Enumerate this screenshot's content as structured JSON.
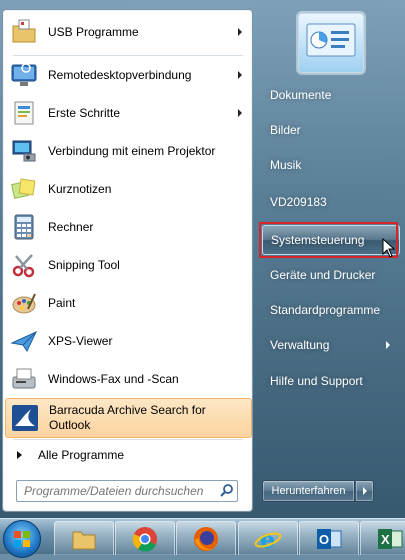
{
  "programs": [
    {
      "label": "USB Programme",
      "icon": "folder-icon",
      "has_submenu": true
    },
    {
      "label": "Remotedesktopverbindung",
      "icon": "remote-desktop-icon",
      "has_submenu": true
    },
    {
      "label": "Erste Schritte",
      "icon": "getting-started-icon",
      "has_submenu": true
    },
    {
      "label": "Verbindung mit einem Projektor",
      "icon": "projector-icon",
      "has_submenu": false
    },
    {
      "label": "Kurznotizen",
      "icon": "sticky-notes-icon",
      "has_submenu": false
    },
    {
      "label": "Rechner",
      "icon": "calculator-icon",
      "has_submenu": false
    },
    {
      "label": "Snipping Tool",
      "icon": "scissors-icon",
      "has_submenu": false
    },
    {
      "label": "Paint",
      "icon": "paint-palette-icon",
      "has_submenu": false
    },
    {
      "label": "XPS-Viewer",
      "icon": "paper-plane-icon",
      "has_submenu": false
    },
    {
      "label": "Windows-Fax und -Scan",
      "icon": "fax-icon",
      "has_submenu": false
    }
  ],
  "highlighted_program": {
    "label": "Barracuda Archive Search for Outlook",
    "icon": "barracuda-icon"
  },
  "all_programs_label": "Alle Programme",
  "search": {
    "placeholder": "Programme/Dateien durchsuchen"
  },
  "places": [
    {
      "label": "Dokumente",
      "selected": false,
      "has_submenu": false
    },
    {
      "label": "Bilder",
      "selected": false,
      "has_submenu": false
    },
    {
      "label": "Musik",
      "selected": false,
      "has_submenu": false
    },
    {
      "label": "VD209183",
      "selected": false,
      "has_submenu": false
    },
    {
      "label": "Systemsteuerung",
      "selected": true,
      "has_submenu": false
    },
    {
      "label": "Geräte und Drucker",
      "selected": false,
      "has_submenu": false
    },
    {
      "label": "Standardprogramme",
      "selected": false,
      "has_submenu": false
    },
    {
      "label": "Verwaltung",
      "selected": false,
      "has_submenu": true
    },
    {
      "label": "Hilfe und Support",
      "selected": false,
      "has_submenu": false
    }
  ],
  "shutdown": {
    "label": "Herunterfahren"
  },
  "taskbar": {
    "items": [
      "start-orb-icon",
      "file-explorer-icon",
      "chrome-icon",
      "firefox-icon",
      "internet-explorer-icon",
      "outlook-icon",
      "excel-icon"
    ]
  },
  "colors": {
    "highlight_border": "#d8242a",
    "highlight_bg": "#fbd3a0"
  }
}
